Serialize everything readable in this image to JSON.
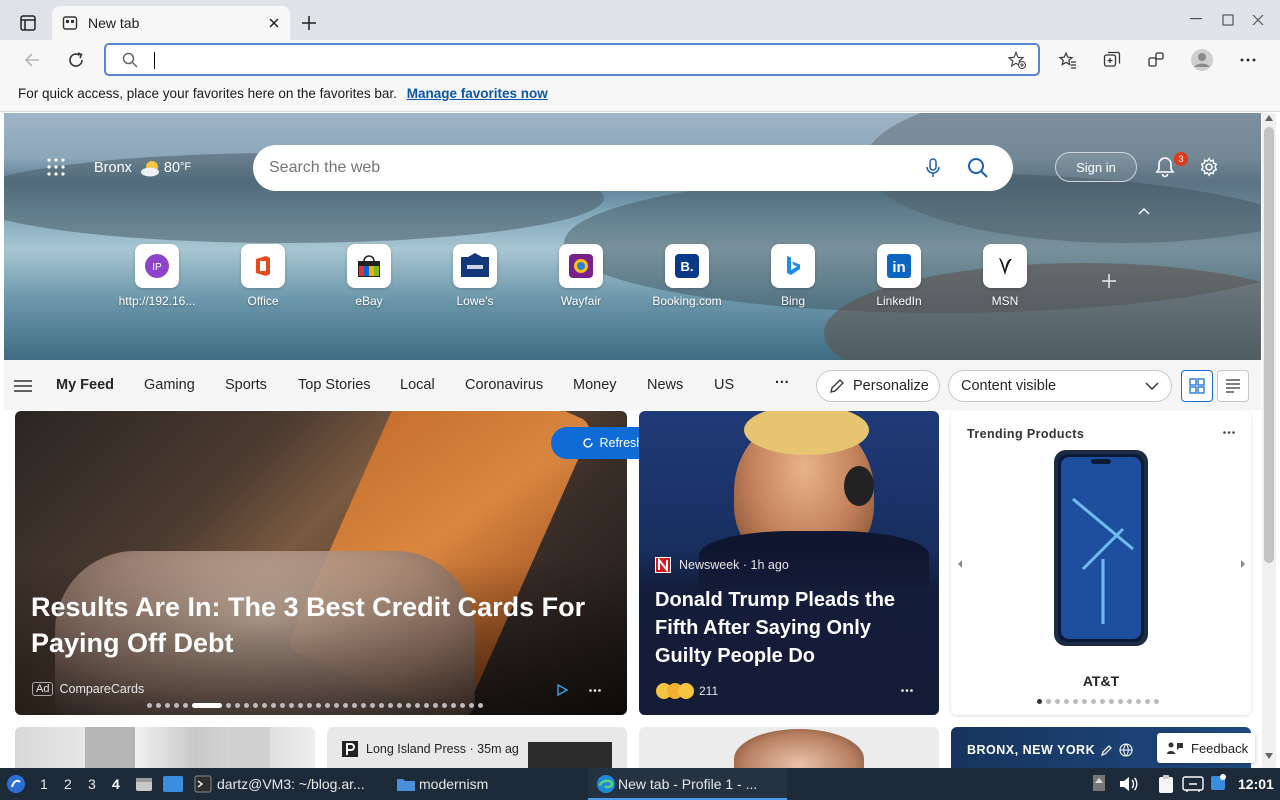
{
  "browser": {
    "tab_title": "New tab",
    "address_value": "",
    "favorites_bar_text": "For quick access, place your favorites here on the favorites bar.",
    "favorites_bar_link": "Manage favorites now"
  },
  "newtab": {
    "location": "Bronx",
    "temperature": "80",
    "temp_unit": "°F",
    "search_placeholder": "Search the web",
    "signin_label": "Sign in",
    "notification_count": "3",
    "tiles": [
      {
        "label": "http://192.16...",
        "icon": "ip-icon"
      },
      {
        "label": "Office",
        "icon": "office-icon"
      },
      {
        "label": "eBay",
        "icon": "ebay-icon"
      },
      {
        "label": "Lowe's",
        "icon": "lowes-icon"
      },
      {
        "label": "Wayfair",
        "icon": "wayfair-icon"
      },
      {
        "label": "Booking.com",
        "icon": "booking-icon"
      },
      {
        "label": "Bing",
        "icon": "bing-icon"
      },
      {
        "label": "LinkedIn",
        "icon": "linkedin-icon"
      },
      {
        "label": "MSN",
        "icon": "msn-icon"
      }
    ],
    "ip_tile_text": "IP",
    "booking_tile_text": "B.",
    "linkedin_tile_text": "in"
  },
  "feed": {
    "nav": [
      "My Feed",
      "Gaming",
      "Sports",
      "Top Stories",
      "Local",
      "Coronavirus",
      "Money",
      "News",
      "US"
    ],
    "more": "···",
    "personalize_label": "Personalize",
    "content_select": "Content visible",
    "refresh_label": "Refresh stories",
    "card1": {
      "title": "Results Are In: The 3 Best Credit Cards For Paying Off Debt",
      "ad_badge": "Ad",
      "source": "CompareCards"
    },
    "card2": {
      "source": "Newsweek · 1h ago",
      "title": "Donald Trump Pleads the Fifth After Saying Only Guilty People Do",
      "reactions": "211"
    },
    "card3": {
      "heading": "Trending Products",
      "product": "AT&T"
    },
    "row2": {
      "card2_source": "Long Island Press · 35m ag",
      "card4_location": "BRONX, NEW YORK",
      "feedback_label": "Feedback"
    }
  },
  "taskbar": {
    "workspaces": [
      "1",
      "2",
      "3",
      "4"
    ],
    "terminal": "dartz@VM3: ~/blog.ar...",
    "folder": "modernism",
    "browser": "New tab - Profile 1 - ...",
    "clock": "12:01"
  },
  "colors": {
    "accent": "#0f6cd6",
    "link": "#0b57a8",
    "taskbar": "#1d2a3a",
    "badge": "#e03a1e"
  }
}
